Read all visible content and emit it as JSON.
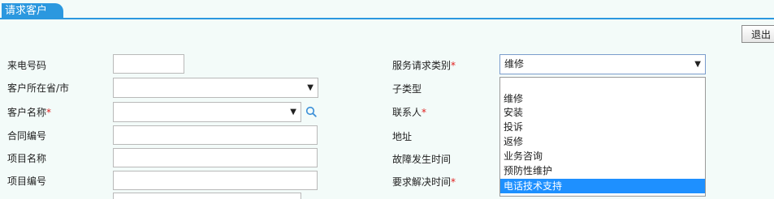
{
  "tab": {
    "title": "请求客户"
  },
  "toolbar": {
    "exit_label": "退出"
  },
  "left_form": {
    "phone_label": "来电号码",
    "province_label": "客户所在省/市",
    "customer_name_label": "客户名称",
    "contract_no_label": "合同编号",
    "project_name_label": "项目名称",
    "project_no_label": "项目编号",
    "required_mark": "*"
  },
  "right_form": {
    "service_type_label": "服务请求类别",
    "service_type_value": "维修",
    "subtype_label": "子类型",
    "contact_label": "联系人",
    "address_label": "地址",
    "fault_time_label": "故障发生时间",
    "resolve_time_label": "要求解决时间"
  },
  "dropdown": {
    "options": [
      "维修",
      "安装",
      "投诉",
      "返修",
      "业务咨询",
      "预防性维护",
      "电话技术支持"
    ],
    "highlighted": "电话技术支持"
  },
  "colors": {
    "accent": "#2b98df",
    "highlight": "#1e90ff",
    "required": "#e02020"
  },
  "icons": {
    "dropdown_arrow": "▼",
    "search": "search-icon"
  }
}
